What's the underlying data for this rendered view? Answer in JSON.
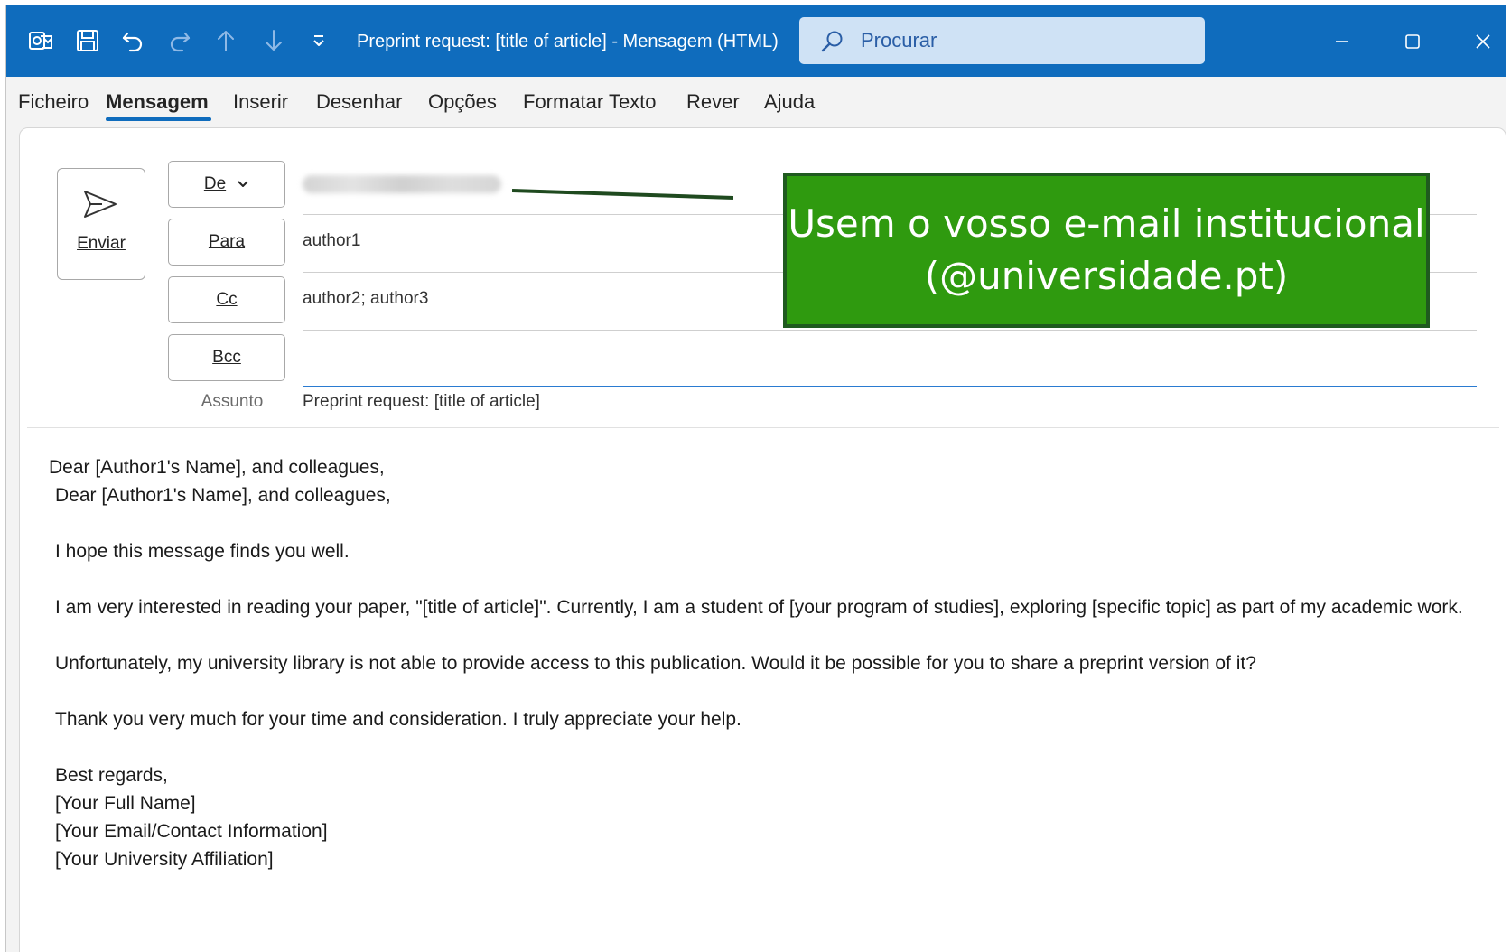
{
  "titlebar": {
    "title": "Preprint request: [title of article]  -  Mensagem (HTML)",
    "search_placeholder": "Procurar",
    "accent_color": "#0f6cbd",
    "icons": [
      "outlook-app-icon",
      "save-icon",
      "undo-icon",
      "redo-icon",
      "up-arrow-icon",
      "down-arrow-icon",
      "customize-dropdown-icon",
      "search-icon",
      "minimize-icon",
      "maximize-icon",
      "close-icon"
    ]
  },
  "menu": {
    "items": [
      {
        "label": "Ficheiro"
      },
      {
        "label": "Mensagem"
      },
      {
        "label": "Inserir"
      },
      {
        "label": "Desenhar"
      },
      {
        "label": "Opções"
      },
      {
        "label": "Formatar Texto"
      },
      {
        "label": "Rever"
      },
      {
        "label": "Ajuda"
      }
    ],
    "active": "Mensagem"
  },
  "compose": {
    "send_label": "Enviar",
    "from_label": "De",
    "to_label": "Para",
    "to_value": "author1",
    "cc_label": "Cc",
    "cc_value": "author2; author3",
    "bcc_label": "Bcc",
    "bcc_value": "",
    "subject_label": "Assunto",
    "subject_value": "Preprint request: [title of article]"
  },
  "body": {
    "lines": [
      "Dear [Author1's Name], and colleagues,",
      "Dear [Author1's Name], and colleagues,",
      "",
      "I hope this message finds you well.",
      "",
      "I am very interested in reading your paper, \"[title of article]\". Currently, I am a student of [your program of studies], exploring [specific topic] as part of my academic work.",
      "",
      "Unfortunately, my university library is not able to provide access to this publication. Would it be possible for you to share a preprint version of it?",
      "",
      "Thank you very much for your time and consideration. I truly appreciate your help.",
      "",
      "Best regards,",
      "[Your Full Name]",
      "[Your Email/Contact Information]",
      "[Your University Affiliation]"
    ]
  },
  "annotation": {
    "line1": "Usem o vosso e-mail institucional",
    "line2": "(@universidade.pt)",
    "color": "#2f9a0f"
  }
}
